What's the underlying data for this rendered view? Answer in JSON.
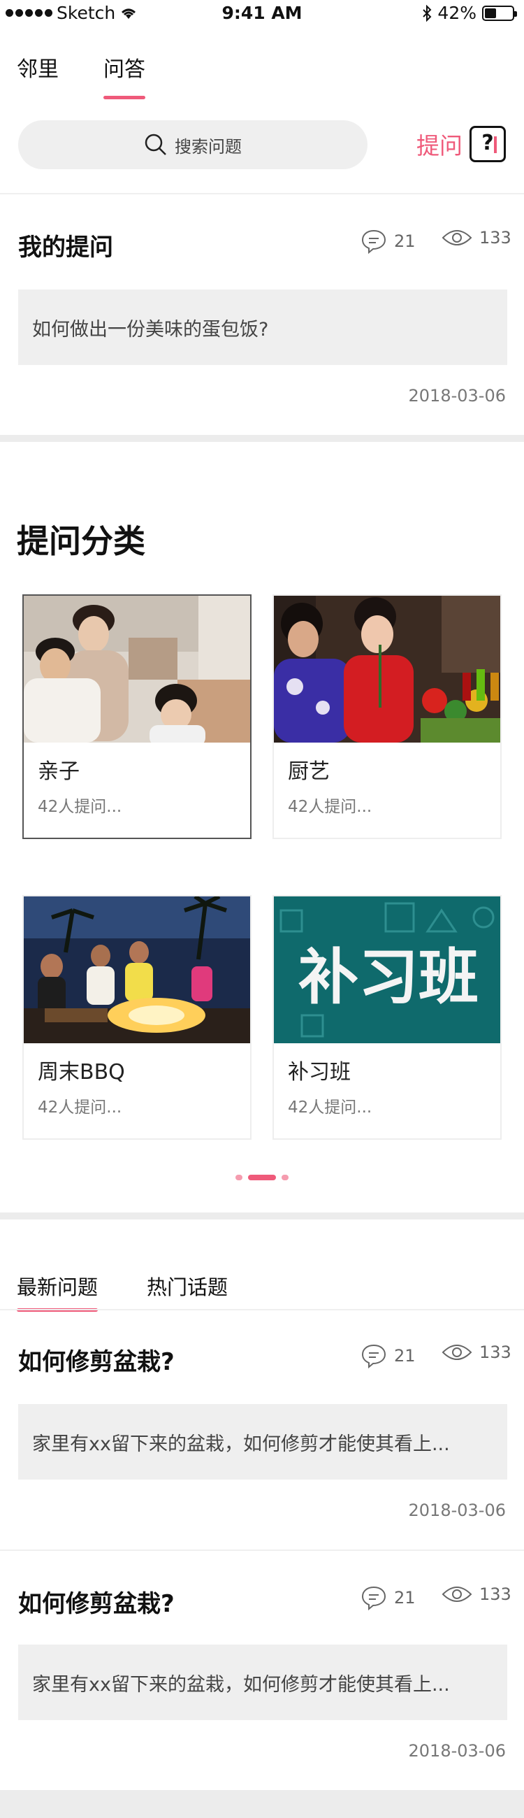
{
  "status_bar": {
    "carrier": "Sketch",
    "time": "9:41 AM",
    "battery": "42%",
    "battery_level": 0.42
  },
  "tabs": [
    {
      "label": "邻里"
    },
    {
      "label": "问答"
    }
  ],
  "search": {
    "placeholder": "搜索问题"
  },
  "ask": {
    "label": "提问"
  },
  "my_question": {
    "section_title": "我的提问",
    "comments": "21",
    "views": "133",
    "text": "如何做出一份美味的蛋包饭?",
    "date": "2018-03-06"
  },
  "category_section": {
    "title": "提问分类",
    "items": [
      {
        "name": "亲子",
        "sub": "42人提问..."
      },
      {
        "name": "厨艺",
        "sub": "42人提问..."
      },
      {
        "name": "周末BBQ",
        "sub": "42人提问..."
      },
      {
        "name": "补习班",
        "sub": "42人提问..."
      }
    ],
    "tutoring_image_text": "补习班"
  },
  "feed_tabs": [
    {
      "label": "最新问题"
    },
    {
      "label": "热门话题"
    }
  ],
  "questions": [
    {
      "title": "如何修剪盆栽?",
      "comments": "21",
      "views": "133",
      "text": "家里有xx留下来的盆栽，如何修剪才能使其看上...",
      "date": "2018-03-06"
    },
    {
      "title": "如何修剪盆栽?",
      "comments": "21",
      "views": "133",
      "text": "家里有xx留下来的盆栽，如何修剪才能使其看上...",
      "date": "2018-03-06"
    }
  ],
  "colors": {
    "accent": "#ef5a7a",
    "panel": "#efefef",
    "divider": "#ececec"
  }
}
